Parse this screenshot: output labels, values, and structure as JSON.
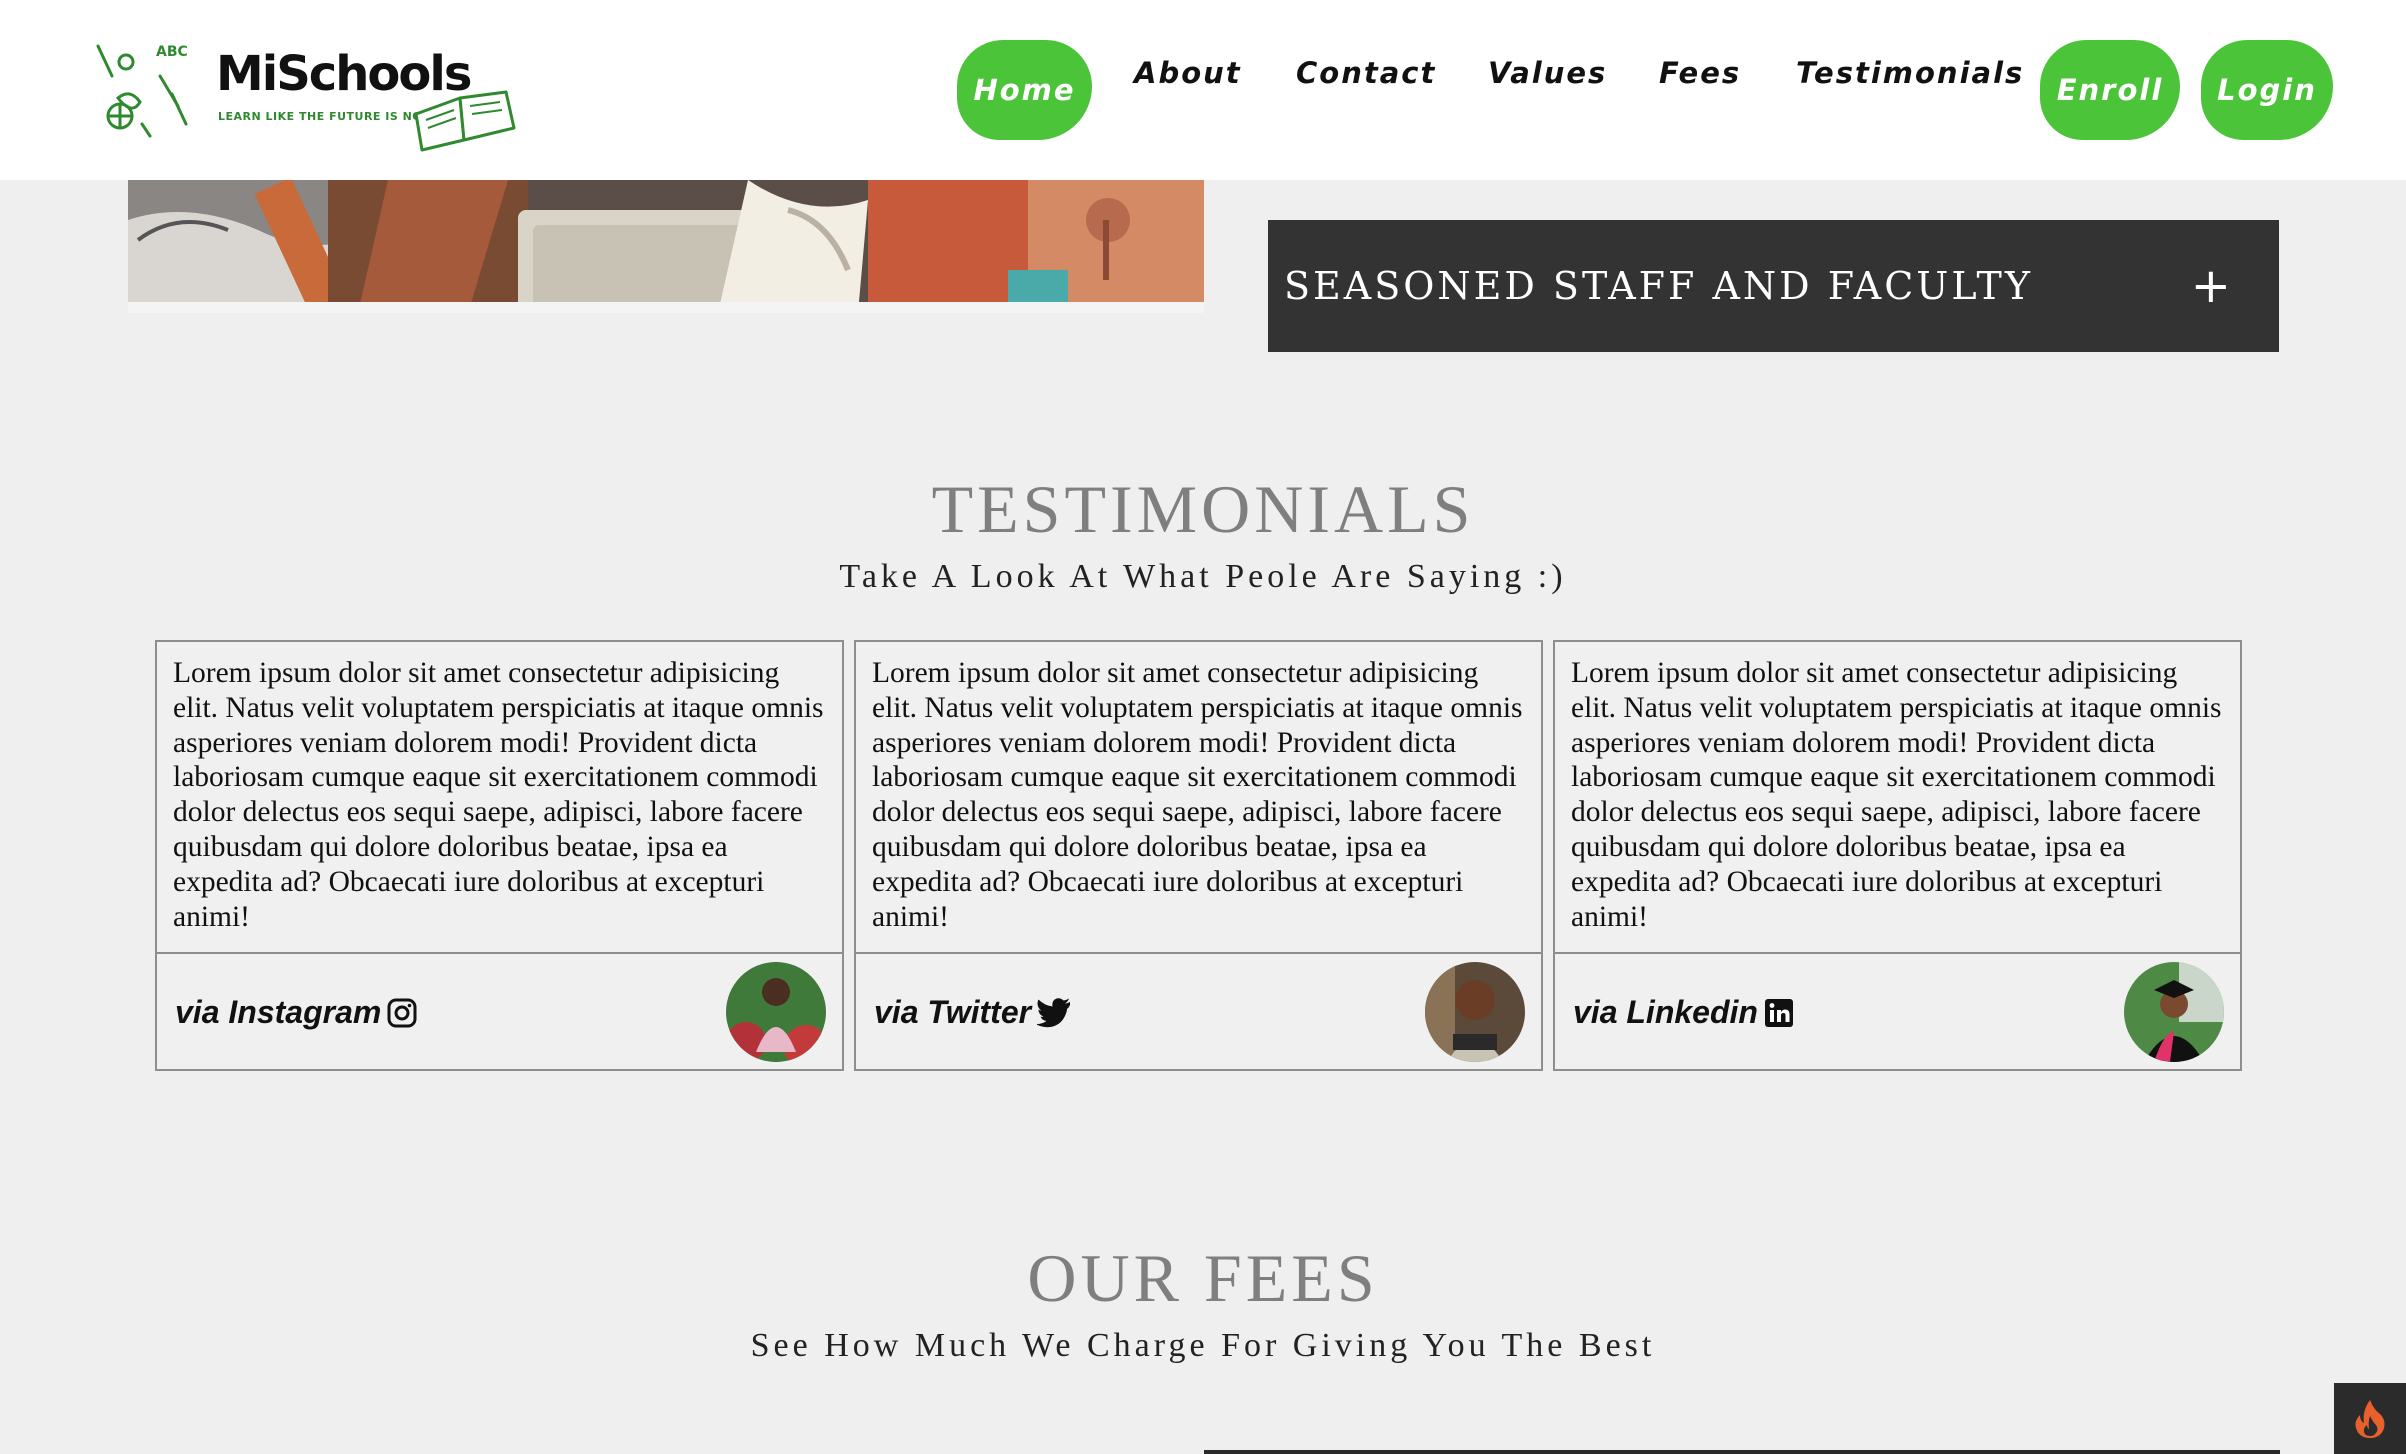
{
  "brand": {
    "name": "MiSchools",
    "tagline": "LEARN LIKE THE FUTURE IS NOW",
    "logo_doodle_text": "ABC"
  },
  "nav": {
    "home": "Home",
    "about": "About",
    "contact": "Contact",
    "values": "Values",
    "fees": "Fees",
    "testimonials": "Testimonials",
    "enroll": "Enroll",
    "login": "Login"
  },
  "accordion": {
    "title": "SEASONED STAFF AND FACULTY",
    "icon": "plus-icon"
  },
  "testimonials": {
    "title": "TESTIMONIALS",
    "subtitle": "Take A Look At What Peole Are Saying :)",
    "cards": [
      {
        "text": "Lorem ipsum dolor sit amet consectetur adipisicing elit. Natus velit voluptatem perspiciatis at itaque omnis asperiores veniam dolorem modi! Provident dicta laboriosam cumque eaque sit exercitationem commodi dolor delectus eos sequi saepe, adipisci, labore facere quibusdam qui dolore doloribus beatae, ipsa ea expedita ad? Obcaecati iure doloribus at excepturi animi!",
        "via": "via Instagram",
        "icon": "instagram-icon"
      },
      {
        "text": "Lorem ipsum dolor sit amet consectetur adipisicing elit. Natus velit voluptatem perspiciatis at itaque omnis asperiores veniam dolorem modi! Provident dicta laboriosam cumque eaque sit exercitationem commodi dolor delectus eos sequi saepe, adipisci, labore facere quibusdam qui dolore doloribus beatae, ipsa ea expedita ad? Obcaecati iure doloribus at excepturi animi!",
        "via": "via Twitter",
        "icon": "twitter-icon"
      },
      {
        "text": "Lorem ipsum dolor sit amet consectetur adipisicing elit. Natus velit voluptatem perspiciatis at itaque omnis asperiores veniam dolorem modi! Provident dicta laboriosam cumque eaque sit exercitationem commodi dolor delectus eos sequi saepe, adipisci, labore facere quibusdam qui dolore doloribus beatae, ipsa ea expedita ad? Obcaecati iure doloribus at excepturi animi!",
        "via": "via Linkedin",
        "icon": "linkedin-icon"
      }
    ]
  },
  "fees": {
    "title": "OUR FEES",
    "subtitle": "See How Much We Charge For Giving You The Best"
  },
  "colors": {
    "accent_green": "#4cc43a",
    "dark_panel": "#333333",
    "heading_gray": "#7f7f7f",
    "page_bg": "#efefef"
  },
  "floating_button": {
    "icon": "fire-icon"
  }
}
